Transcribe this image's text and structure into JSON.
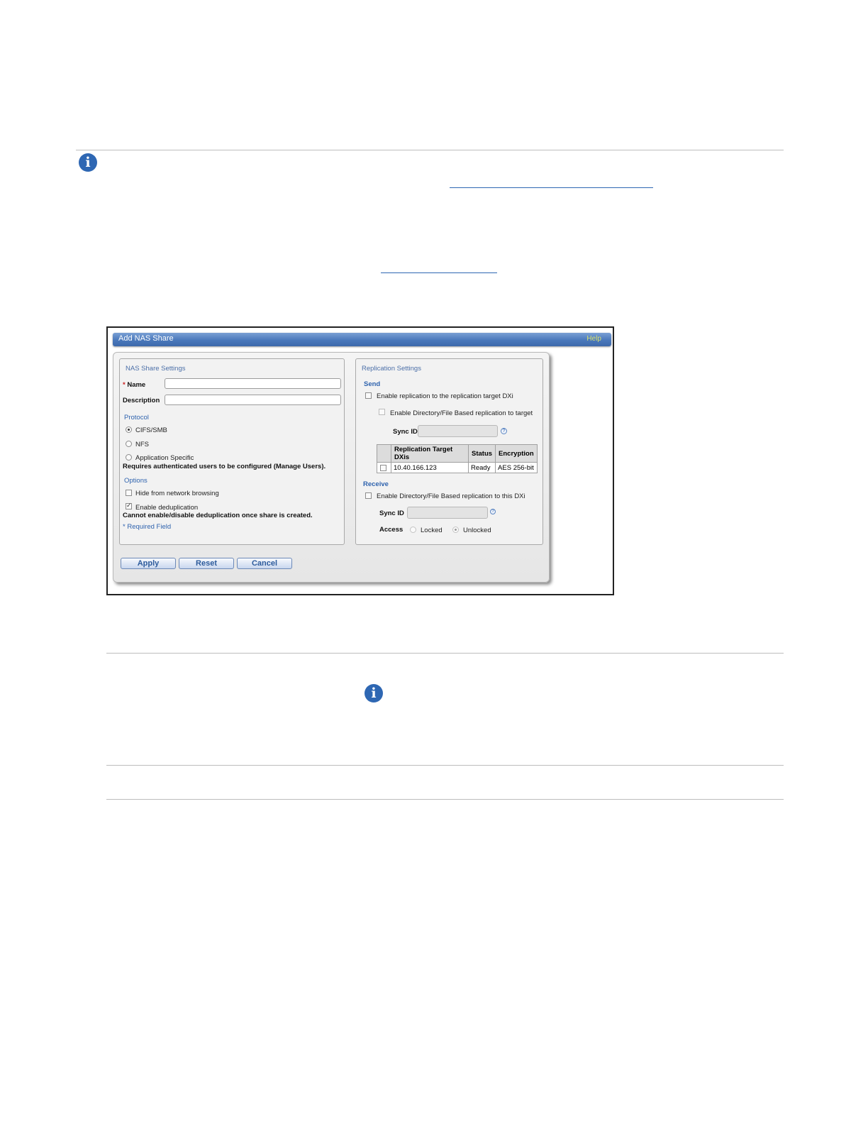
{
  "dialog": {
    "title": "Add NAS Share",
    "help_label": "Help",
    "nas": {
      "legend": "NAS Share Settings",
      "name_label": "Name",
      "required_star": "*",
      "description_label": "Description",
      "protocol_heading": "Protocol",
      "protocols": [
        {
          "label": "CIFS/SMB",
          "selected": true
        },
        {
          "label": "NFS",
          "selected": false
        },
        {
          "label": "Application Specific",
          "selected": false
        }
      ],
      "protocol_note": "Requires authenticated users to be configured (Manage Users).",
      "options_heading": "Options",
      "hide_browsing_label": "Hide from network browsing",
      "dedup_label": "Enable deduplication",
      "dedup_note": "Cannot enable/disable deduplication once share is created.",
      "required_field_note": "* Required Field"
    },
    "replication": {
      "legend": "Replication Settings",
      "send_heading": "Send",
      "enable_replication_label": "Enable replication to the replication target DXi",
      "enable_dir_label": "Enable Directory/File Based replication to target",
      "sync_id_label": "Sync ID",
      "table": {
        "columns": [
          "Replication Target DXis",
          "Status",
          "Encryption"
        ],
        "rows": [
          {
            "target": "10.40.166.123",
            "status": "Ready",
            "encryption": "AES 256-bit"
          }
        ]
      },
      "receive_heading": "Receive",
      "enable_receive_label": "Enable Directory/File Based replication to this DXi",
      "receive_sync_id_label": "Sync ID",
      "access_label": "Access",
      "access_locked": "Locked",
      "access_unlocked": "Unlocked",
      "help_glyph": "?"
    },
    "buttons": {
      "apply": "Apply",
      "reset": "Reset",
      "cancel": "Cancel"
    }
  },
  "info_glyph": "i"
}
